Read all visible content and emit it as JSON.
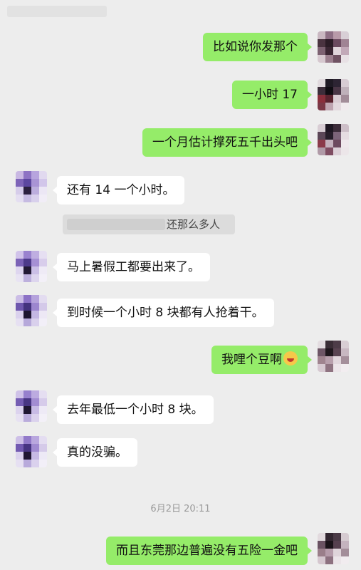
{
  "header": {
    "contact_name_blurred": ""
  },
  "messages": [
    {
      "side": "right",
      "text": "比如说你发那个"
    },
    {
      "side": "right",
      "text": "一小时 17"
    },
    {
      "side": "right",
      "text": "一个月估计撑死五千出头吧"
    },
    {
      "side": "left",
      "text": "还有 14 一个小时。"
    },
    {
      "side": "system",
      "text": "还那么多人"
    },
    {
      "side": "left",
      "text": "马上暑假工都要出来了。"
    },
    {
      "side": "left",
      "text": "到时候一个小时 8 块都有人抢着干。"
    },
    {
      "side": "right",
      "text": "我哩个豆啊",
      "emoji": "laughing-crying-emoji"
    },
    {
      "side": "left",
      "text": "去年最低一个小时 8 块。"
    },
    {
      "side": "left",
      "text": "真的没骗。"
    },
    {
      "side": "timestamp",
      "text": "6月2日 20:11"
    },
    {
      "side": "right",
      "text": "而且东莞那边普遍没有五险一金吧"
    }
  ],
  "colors": {
    "background": "#ededed",
    "outgoing_bubble": "#95ec69",
    "incoming_bubble": "#ffffff"
  }
}
